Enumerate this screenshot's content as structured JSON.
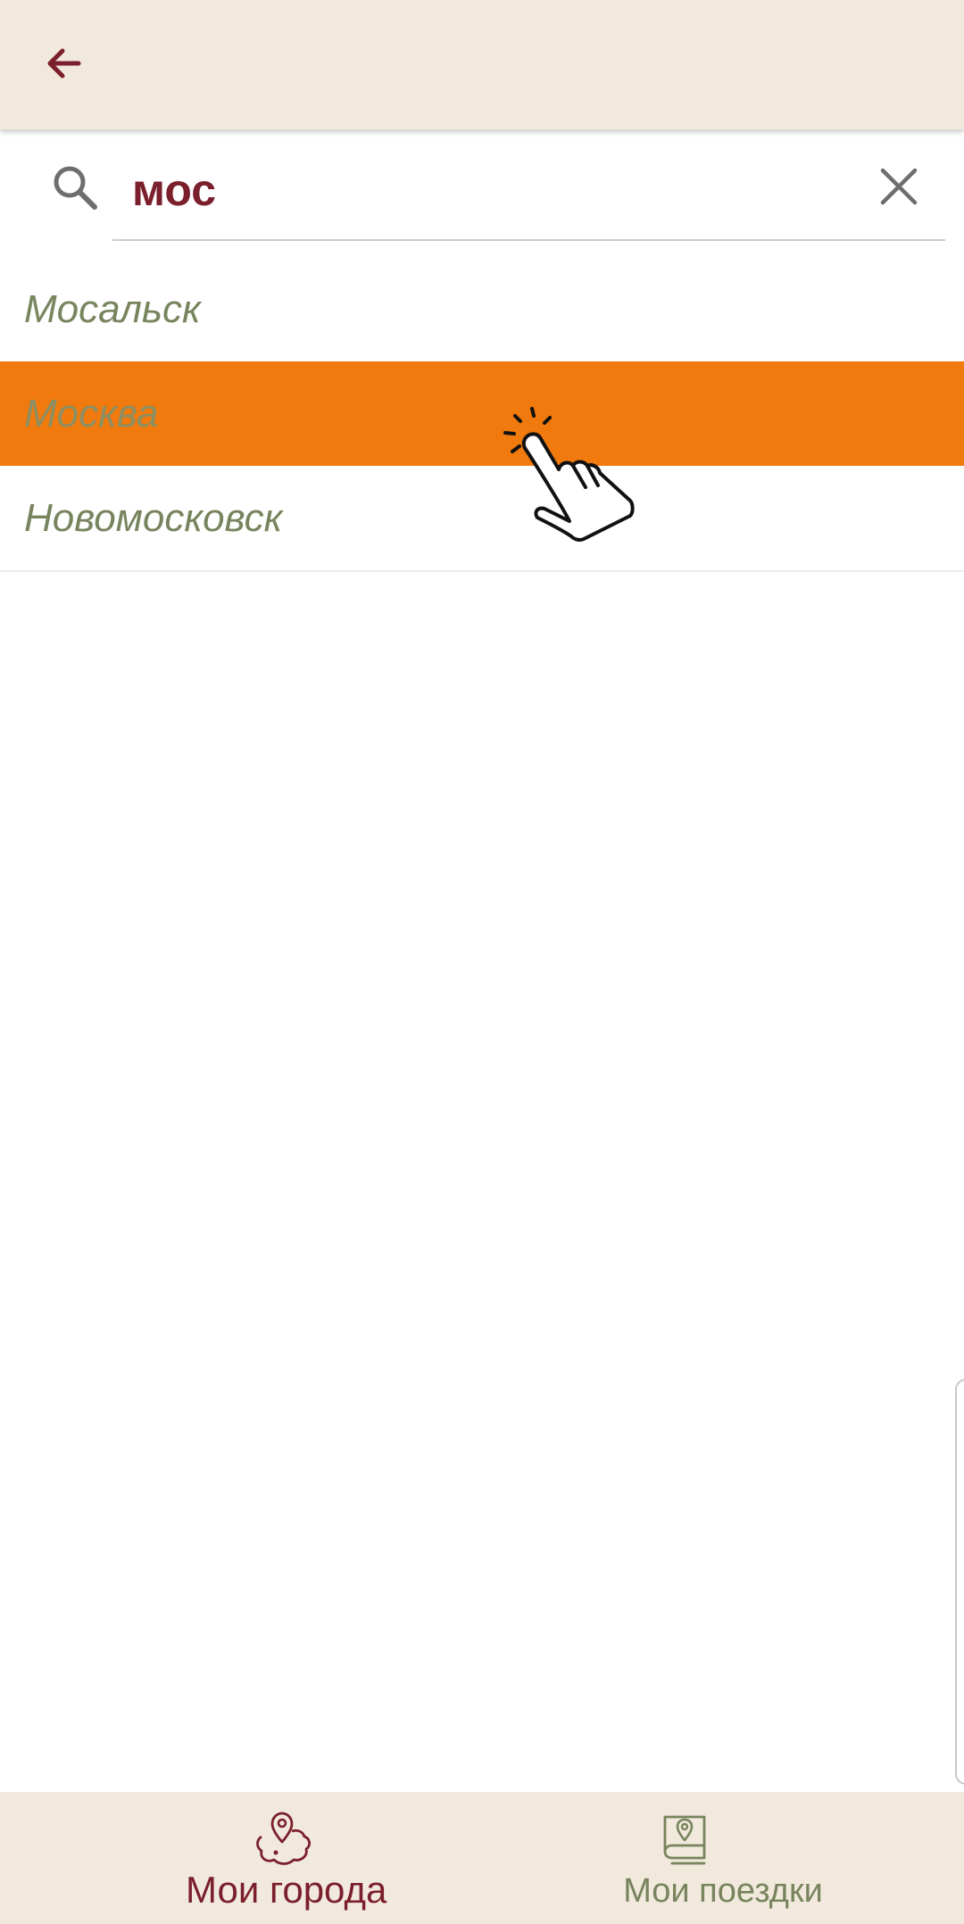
{
  "colors": {
    "accent": "#7a1f2b",
    "secondary": "#77845d",
    "highlight": "#f07a0d",
    "bar_background": "#f2e9dd"
  },
  "header": {
    "back_icon": "arrow-left-icon"
  },
  "search": {
    "value": "мос",
    "icon": "search-icon",
    "clear_icon": "close-icon"
  },
  "results": [
    {
      "label": "Мосальск",
      "selected": false
    },
    {
      "label": "Москва",
      "selected": true
    },
    {
      "label": "Новомосковск",
      "selected": false
    }
  ],
  "bottom_nav": {
    "items": [
      {
        "label": "Мои города",
        "icon": "city-map-pin-icon",
        "active": true
      },
      {
        "label": "Мои поездки",
        "icon": "trip-book-icon",
        "active": false
      }
    ]
  }
}
